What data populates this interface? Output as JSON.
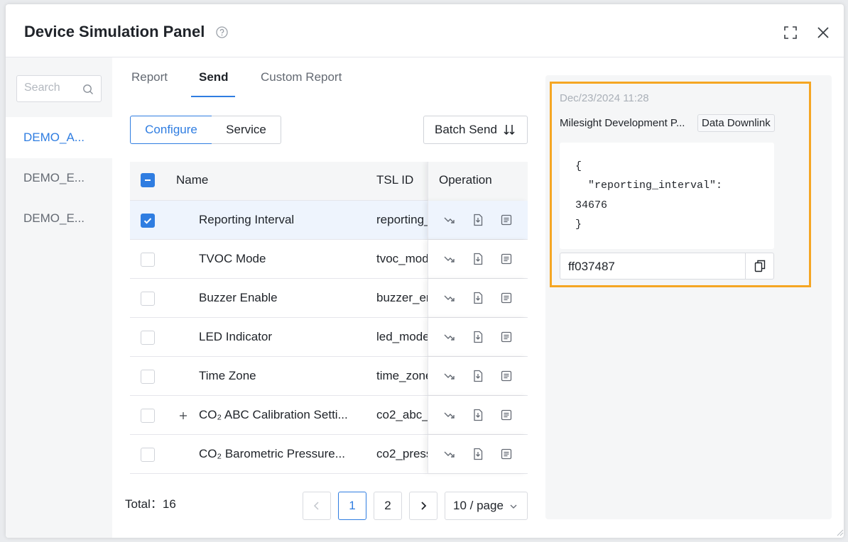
{
  "modal": {
    "title": "Device Simulation Panel"
  },
  "sidebar": {
    "search_placeholder": "Search",
    "items": [
      {
        "label": "DEMO_A..."
      },
      {
        "label": "DEMO_E..."
      },
      {
        "label": "DEMO_E..."
      }
    ]
  },
  "tabs": [
    {
      "label": "Report"
    },
    {
      "label": "Send"
    },
    {
      "label": "Custom Report"
    }
  ],
  "toolbar": {
    "configure_label": "Configure",
    "service_label": "Service",
    "batch_send_label": "Batch Send"
  },
  "table": {
    "headers": {
      "name": "Name",
      "tsl_id": "TSL ID",
      "operation": "Operation"
    },
    "rows": [
      {
        "name": "Reporting Interval",
        "tsl_id": "reporting_",
        "checked": true
      },
      {
        "name": "TVOC Mode",
        "tsl_id": "tvoc_mod",
        "checked": false
      },
      {
        "name": "Buzzer Enable",
        "tsl_id": "buzzer_er",
        "checked": false
      },
      {
        "name": "LED Indicator",
        "tsl_id": "led_mode",
        "checked": false
      },
      {
        "name": "Time Zone",
        "tsl_id": "time_zone",
        "checked": false
      },
      {
        "name": "CO₂ ABC Calibration Setti...",
        "tsl_id": "co2_abc_",
        "checked": false,
        "expandable": true
      },
      {
        "name": "CO₂ Barometric Pressure...",
        "tsl_id": "co2_press",
        "checked": false
      }
    ]
  },
  "pagination": {
    "total_label": "Total：",
    "total": "16",
    "pages": [
      "1",
      "2"
    ],
    "current": "1",
    "page_size": "10 / page"
  },
  "message": {
    "time": "Dec/23/2024 11:28",
    "source": "Milesight Development P...",
    "tag": "Data Downlink",
    "code_lines": [
      "{",
      "  \"reporting_interval\":",
      "34676",
      "}"
    ],
    "hex": "ff037487"
  },
  "colors": {
    "accent": "#2f7de1",
    "highlight": "#f5a623"
  }
}
